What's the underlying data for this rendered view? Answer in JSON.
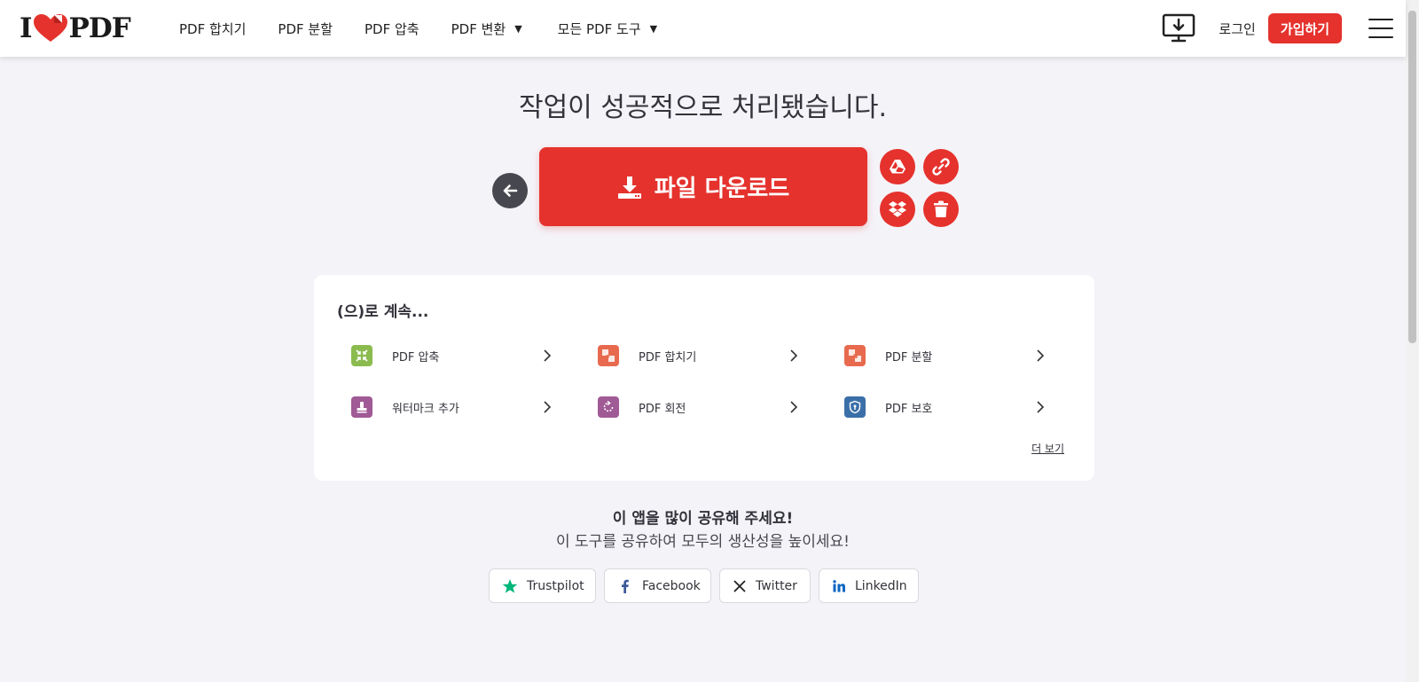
{
  "header": {
    "logo_left": "I",
    "logo_right": "PDF",
    "nav": [
      {
        "label": "PDF 합치기"
      },
      {
        "label": "PDF 분할"
      },
      {
        "label": "PDF 압축"
      },
      {
        "label": "PDF 변환",
        "dropdown": true
      },
      {
        "label": "모든 PDF 도구",
        "dropdown": true
      }
    ],
    "login_label": "로그인",
    "signup_label": "가입하기"
  },
  "main": {
    "headline": "작업이 성공적으로 처리됐습니다.",
    "download_label": "파일 다운로드"
  },
  "continue": {
    "title": "(으)로 계속...",
    "tools": [
      {
        "label": "PDF 압축",
        "icon": "compress-icon",
        "color": "#8bbb4f"
      },
      {
        "label": "PDF 합치기",
        "icon": "merge-icon",
        "color": "#e86a4e"
      },
      {
        "label": "PDF 분할",
        "icon": "split-icon",
        "color": "#e86a4e"
      },
      {
        "label": "워터마크 추가",
        "icon": "watermark-icon",
        "color": "#a05a95"
      },
      {
        "label": "PDF 회전",
        "icon": "rotate-icon",
        "color": "#a05a95"
      },
      {
        "label": "PDF 보호",
        "icon": "shield-icon",
        "color": "#3a6fa8"
      }
    ],
    "more_label": "더 보기"
  },
  "share": {
    "title": "이 앱을 많이 공유해 주세요!",
    "subtitle": "이 도구를 공유하여 모두의 생산성을 높이세요!",
    "buttons": [
      {
        "label": "Trustpilot"
      },
      {
        "label": "Facebook"
      },
      {
        "label": "Twitter"
      },
      {
        "label": "LinkedIn"
      }
    ]
  },
  "colors": {
    "brand": "#e5322d",
    "background": "#f4f3f8"
  }
}
